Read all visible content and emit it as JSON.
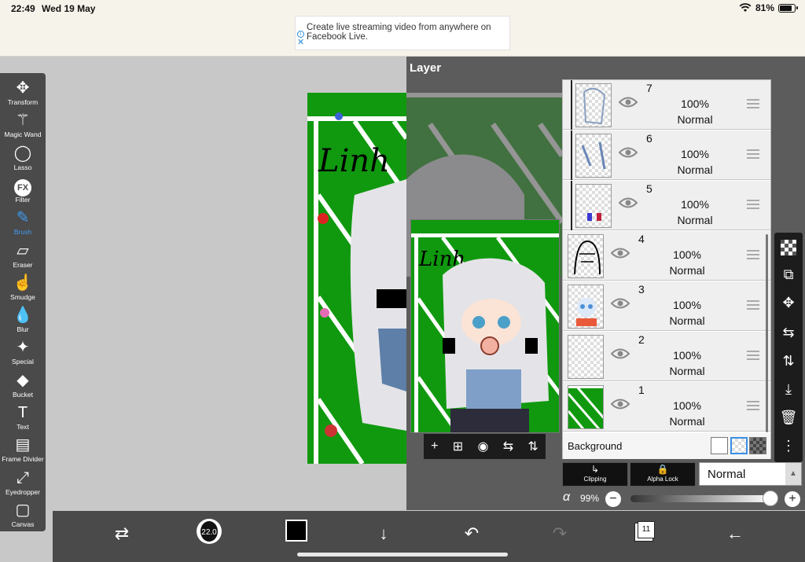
{
  "status_bar": {
    "time": "22:49",
    "date": "Wed 19 May",
    "battery": "81%",
    "battery_fraction": 0.81
  },
  "ad": {
    "text": "Create live streaming video from anywhere on Facebook Live."
  },
  "tools": [
    {
      "label": "Transform",
      "icon": "move-arrows-icon"
    },
    {
      "label": "Magic Wand",
      "icon": "magic-wand-icon"
    },
    {
      "label": "Lasso",
      "icon": "lasso-icon"
    },
    {
      "label": "Filter",
      "icon": "fx-icon",
      "glyph": "FX"
    },
    {
      "label": "Brush",
      "icon": "brush-icon",
      "active": true
    },
    {
      "label": "Eraser",
      "icon": "eraser-icon"
    },
    {
      "label": "Smudge",
      "icon": "smudge-icon"
    },
    {
      "label": "Blur",
      "icon": "blur-drop-icon"
    },
    {
      "label": "Special",
      "icon": "special-sparkle-icon"
    },
    {
      "label": "Bucket",
      "icon": "bucket-icon"
    },
    {
      "label": "Text",
      "icon": "text-icon",
      "glyph": "T"
    },
    {
      "label": "Frame Divider",
      "icon": "frame-divider-icon"
    },
    {
      "label": "Eyedropper",
      "icon": "eyedropper-icon"
    },
    {
      "label": "Canvas",
      "icon": "canvas-icon"
    }
  ],
  "canvas": {
    "title_text": "Linh",
    "accent_green": "#10990f"
  },
  "layer_panel": {
    "title": "Layer",
    "layers": [
      {
        "number": "7",
        "opacity": "100%",
        "mode": "Normal",
        "clipped": true
      },
      {
        "number": "6",
        "opacity": "100%",
        "mode": "Normal",
        "clipped": true
      },
      {
        "number": "5",
        "opacity": "100%",
        "mode": "Normal",
        "clipped": true
      },
      {
        "number": "4",
        "opacity": "100%",
        "mode": "Normal",
        "clipped": false
      },
      {
        "number": "3",
        "opacity": "100%",
        "mode": "Normal",
        "clipped": false
      },
      {
        "number": "2",
        "opacity": "100%",
        "mode": "Normal",
        "clipped": false
      },
      {
        "number": "1",
        "opacity": "100%",
        "mode": "Normal",
        "clipped": false
      }
    ],
    "background_label": "Background",
    "clipping_label": "Clipping",
    "alpha_lock_label": "Alpha Lock",
    "blend_mode": "Normal",
    "alpha_symbol": "α",
    "alpha_value": "99%",
    "alpha_fraction": 0.99
  },
  "bottom_bar": {
    "brush_size": "22.0",
    "color": "#000000",
    "layers_count": "11"
  }
}
